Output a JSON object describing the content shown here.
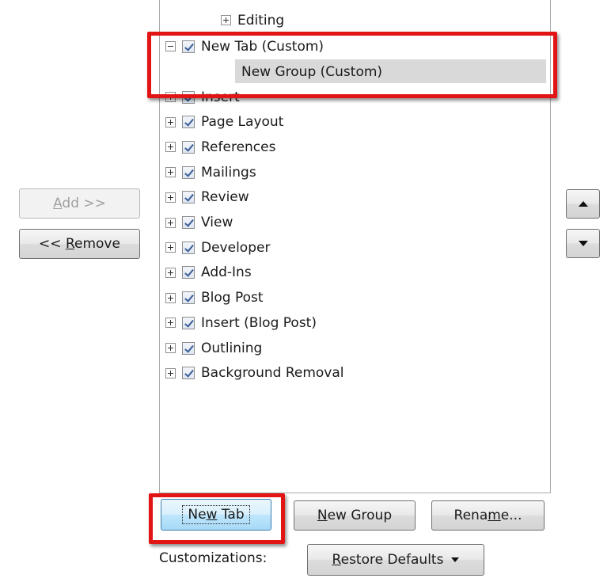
{
  "buttons": {
    "add": {
      "before": "",
      "mnemonic": "A",
      "after": "dd >>"
    },
    "remove": {
      "before": "<< ",
      "mnemonic": "R",
      "after": "emove"
    },
    "new_tab": {
      "before": "Ne",
      "mnemonic": "w",
      "after": " Tab"
    },
    "new_group": {
      "before": "",
      "mnemonic": "N",
      "after": "ew Group"
    },
    "rename": {
      "before": "Rena",
      "mnemonic": "m",
      "after": "e..."
    },
    "restore": {
      "before": "",
      "mnemonic": "R",
      "after": "estore Defaults"
    }
  },
  "customizations_label": "Customizations:",
  "tree": {
    "editing": "Editing",
    "new_tab": "New Tab (Custom)",
    "new_group": "New Group (Custom)",
    "tabs": [
      "Insert",
      "Page Layout",
      "References",
      "Mailings",
      "Review",
      "View",
      "Developer",
      "Add-Ins",
      "Blog Post",
      "Insert (Blog Post)",
      "Outlining",
      "Background Removal"
    ]
  },
  "icons": {
    "move_up": "triangle-up-icon",
    "move_down": "triangle-down-icon",
    "restore_dropdown": "caret-down-icon"
  },
  "colors": {
    "highlight": "#e21414",
    "selection": "#d9d9d9"
  }
}
